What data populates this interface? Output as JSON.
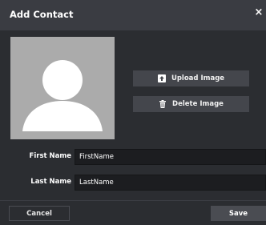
{
  "dialog": {
    "title": "Add Contact",
    "close_glyph": "×"
  },
  "avatar": {
    "icon": "user-silhouette-icon"
  },
  "actions": {
    "upload_label": "Upload Image",
    "upload_icon": "upload-icon",
    "delete_label": "Delete Image",
    "delete_icon": "trash-icon"
  },
  "form": {
    "first_name": {
      "label": "First Name",
      "value": "FirstName"
    },
    "last_name": {
      "label": "Last Name",
      "value": "LastName"
    }
  },
  "footer": {
    "cancel_label": "Cancel",
    "save_label": "Save"
  },
  "colors": {
    "background": "#2b2d31",
    "titlebar": "#3a3c42",
    "avatar_bg": "#ababab",
    "button": "#44464c",
    "input_bg": "#1c1d20"
  }
}
